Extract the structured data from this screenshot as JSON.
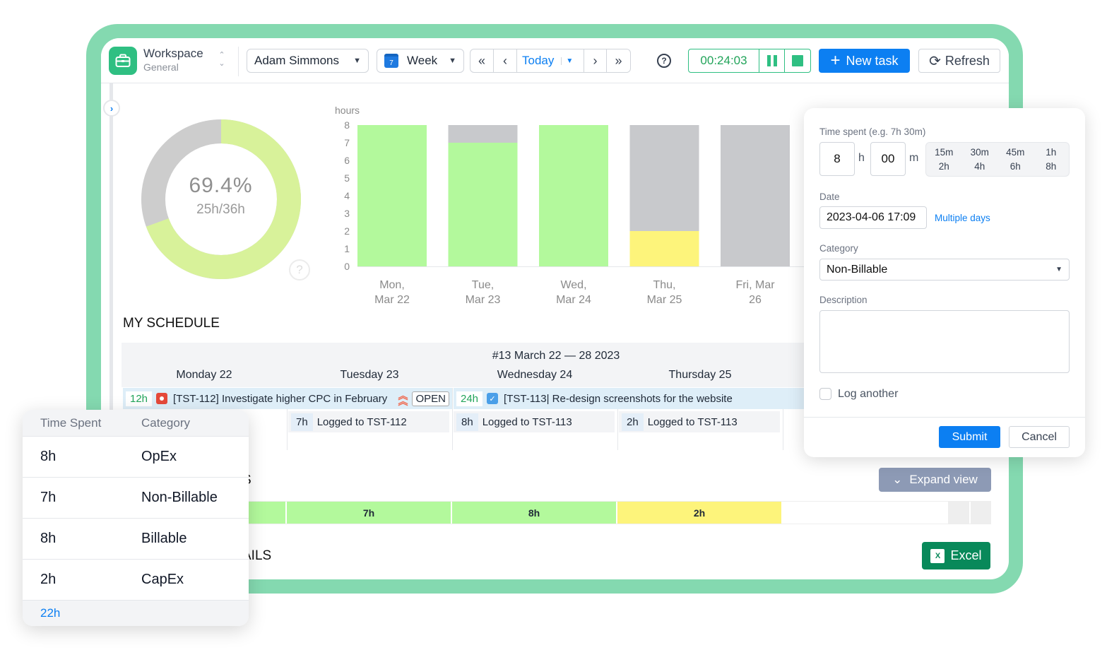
{
  "toolbar": {
    "workspace_title": "Workspace",
    "workspace_sub": "General",
    "user_select": "Adam Simmons",
    "period_select": "Week",
    "calendar_day": "7",
    "today_label": "Today",
    "timer": "00:24:03",
    "new_task_label": "New task",
    "refresh_label": "Refresh"
  },
  "donut": {
    "percent_label": "69.4%",
    "hours_label": "25h/36h",
    "fraction": 0.694
  },
  "chart_data": {
    "type": "bar",
    "ylabel": "hours",
    "ylim": [
      0,
      8
    ],
    "yticks": [
      "0",
      "1",
      "2",
      "3",
      "4",
      "5",
      "6",
      "7",
      "8"
    ],
    "categories": [
      [
        "Mon,",
        "Mar 22"
      ],
      [
        "Tue,",
        "Mar 23"
      ],
      [
        "Wed,",
        "Mar 24"
      ],
      [
        "Thu,",
        "Mar 25"
      ],
      [
        "Fri, Mar",
        "26"
      ]
    ],
    "series": [
      {
        "name": "logged",
        "values": [
          8,
          7,
          8,
          2,
          0
        ],
        "colors": [
          "#b3f99c",
          "#b3f99c",
          "#b3f99c",
          "#fdf47b",
          "#b3f99c"
        ]
      },
      {
        "name": "remaining",
        "values": [
          0,
          1,
          0,
          6,
          8
        ],
        "color": "#c8c9cc"
      }
    ]
  },
  "schedule": {
    "title": "MY SCHEDULE",
    "week_label": "#13 March 22 — 28 2023",
    "days": [
      "Monday 22",
      "Tuesday 23",
      "Wednesday 24",
      "Thursday 25"
    ],
    "tasks": [
      {
        "hours": "12h",
        "title": "[TST-112] Investigate higher CPC in February",
        "status": "OPEN"
      },
      {
        "hours": "24h",
        "title": "[TST-113| Re-design screenshots for the website"
      }
    ],
    "logs": [
      {
        "hours": "7h",
        "label": "Logged to TST-112"
      },
      {
        "hours": "8h",
        "label": "Logged to TST-113"
      },
      {
        "hours": "2h",
        "label": "Logged to TST-113"
      }
    ]
  },
  "summary": {
    "section_title_fragment": "S",
    "expand_label": "Expand view",
    "cells": [
      "",
      "7h",
      "8h",
      "2h",
      ""
    ]
  },
  "details": {
    "section_title_fragment": "AILS",
    "excel_label": "Excel"
  },
  "log_popup": {
    "time_label": "Time spent (e.g. 7h 30m)",
    "hours_value": "8",
    "hours_unit": "h",
    "minutes_value": "00",
    "minutes_unit": "m",
    "quick_options": [
      "15m",
      "30m",
      "45m",
      "1h",
      "2h",
      "4h",
      "6h",
      "8h"
    ],
    "date_label": "Date",
    "date_value": "2023-04-06 17:09",
    "multiple_days_label": "Multiple days",
    "category_label": "Category",
    "category_value": "Non-Billable",
    "description_label": "Description",
    "description_value": "",
    "log_another_label": "Log another",
    "log_another_checked": false,
    "submit_label": "Submit",
    "cancel_label": "Cancel"
  },
  "breakdown": {
    "headers": [
      "Time Spent",
      "Category"
    ],
    "rows": [
      {
        "time": "8h",
        "category": "OpEx"
      },
      {
        "time": "7h",
        "category": "Non-Billable"
      },
      {
        "time": "8h",
        "category": "Billable"
      },
      {
        "time": "2h",
        "category": "CapEx"
      }
    ],
    "total": "22h"
  }
}
